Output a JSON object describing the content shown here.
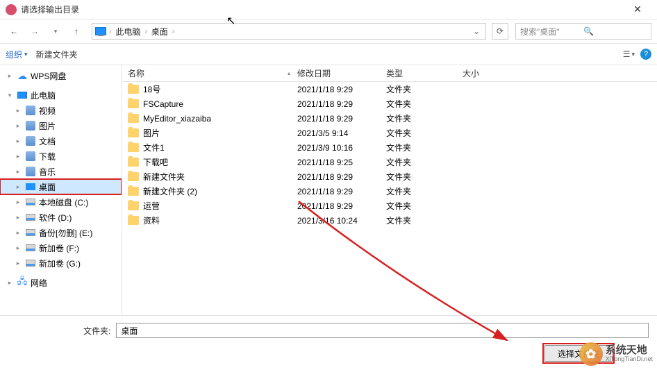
{
  "window": {
    "title": "请选择输出目录"
  },
  "nav": {
    "breadcrumb": [
      "此电脑",
      "桌面"
    ],
    "search_placeholder": "搜索\"桌面\""
  },
  "toolbar": {
    "organize": "组织",
    "new_folder": "新建文件夹"
  },
  "tree": {
    "wps": "WPS网盘",
    "pc": "此电脑",
    "video": "视频",
    "pictures": "图片",
    "documents": "文档",
    "downloads": "下载",
    "music": "音乐",
    "desktop": "桌面",
    "disk_c": "本地磁盘 (C:)",
    "disk_d": "软件 (D:)",
    "disk_e": "备份[勿删] (E:)",
    "disk_f": "新加卷 (F:)",
    "disk_g": "新加卷 (G:)",
    "network": "网络"
  },
  "columns": {
    "name": "名称",
    "date": "修改日期",
    "type": "类型",
    "size": "大小"
  },
  "type_folder": "文件夹",
  "files": [
    {
      "name": "18号",
      "date": "2021/1/18 9:29",
      "type": "文件夹"
    },
    {
      "name": "FSCapture",
      "date": "2021/1/18 9:29",
      "type": "文件夹"
    },
    {
      "name": "MyEditor_xiazaiba",
      "date": "2021/1/18 9:29",
      "type": "文件夹"
    },
    {
      "name": "图片",
      "date": "2021/3/5 9:14",
      "type": "文件夹"
    },
    {
      "name": "文件1",
      "date": "2021/3/9 10:16",
      "type": "文件夹"
    },
    {
      "name": "下载吧",
      "date": "2021/1/18 9:25",
      "type": "文件夹"
    },
    {
      "name": "新建文件夹",
      "date": "2021/1/18 9:29",
      "type": "文件夹"
    },
    {
      "name": "新建文件夹 (2)",
      "date": "2021/1/18 9:29",
      "type": "文件夹"
    },
    {
      "name": "运营",
      "date": "2021/1/18 9:29",
      "type": "文件夹"
    },
    {
      "name": "资料",
      "date": "2021/3/16 10:24",
      "type": "文件夹"
    }
  ],
  "footer": {
    "folder_label": "文件夹:",
    "folder_value": "桌面",
    "select_button": "选择文件夹"
  },
  "watermark": {
    "line1": "系统天地",
    "line2": "XiTongTianDi.net"
  }
}
